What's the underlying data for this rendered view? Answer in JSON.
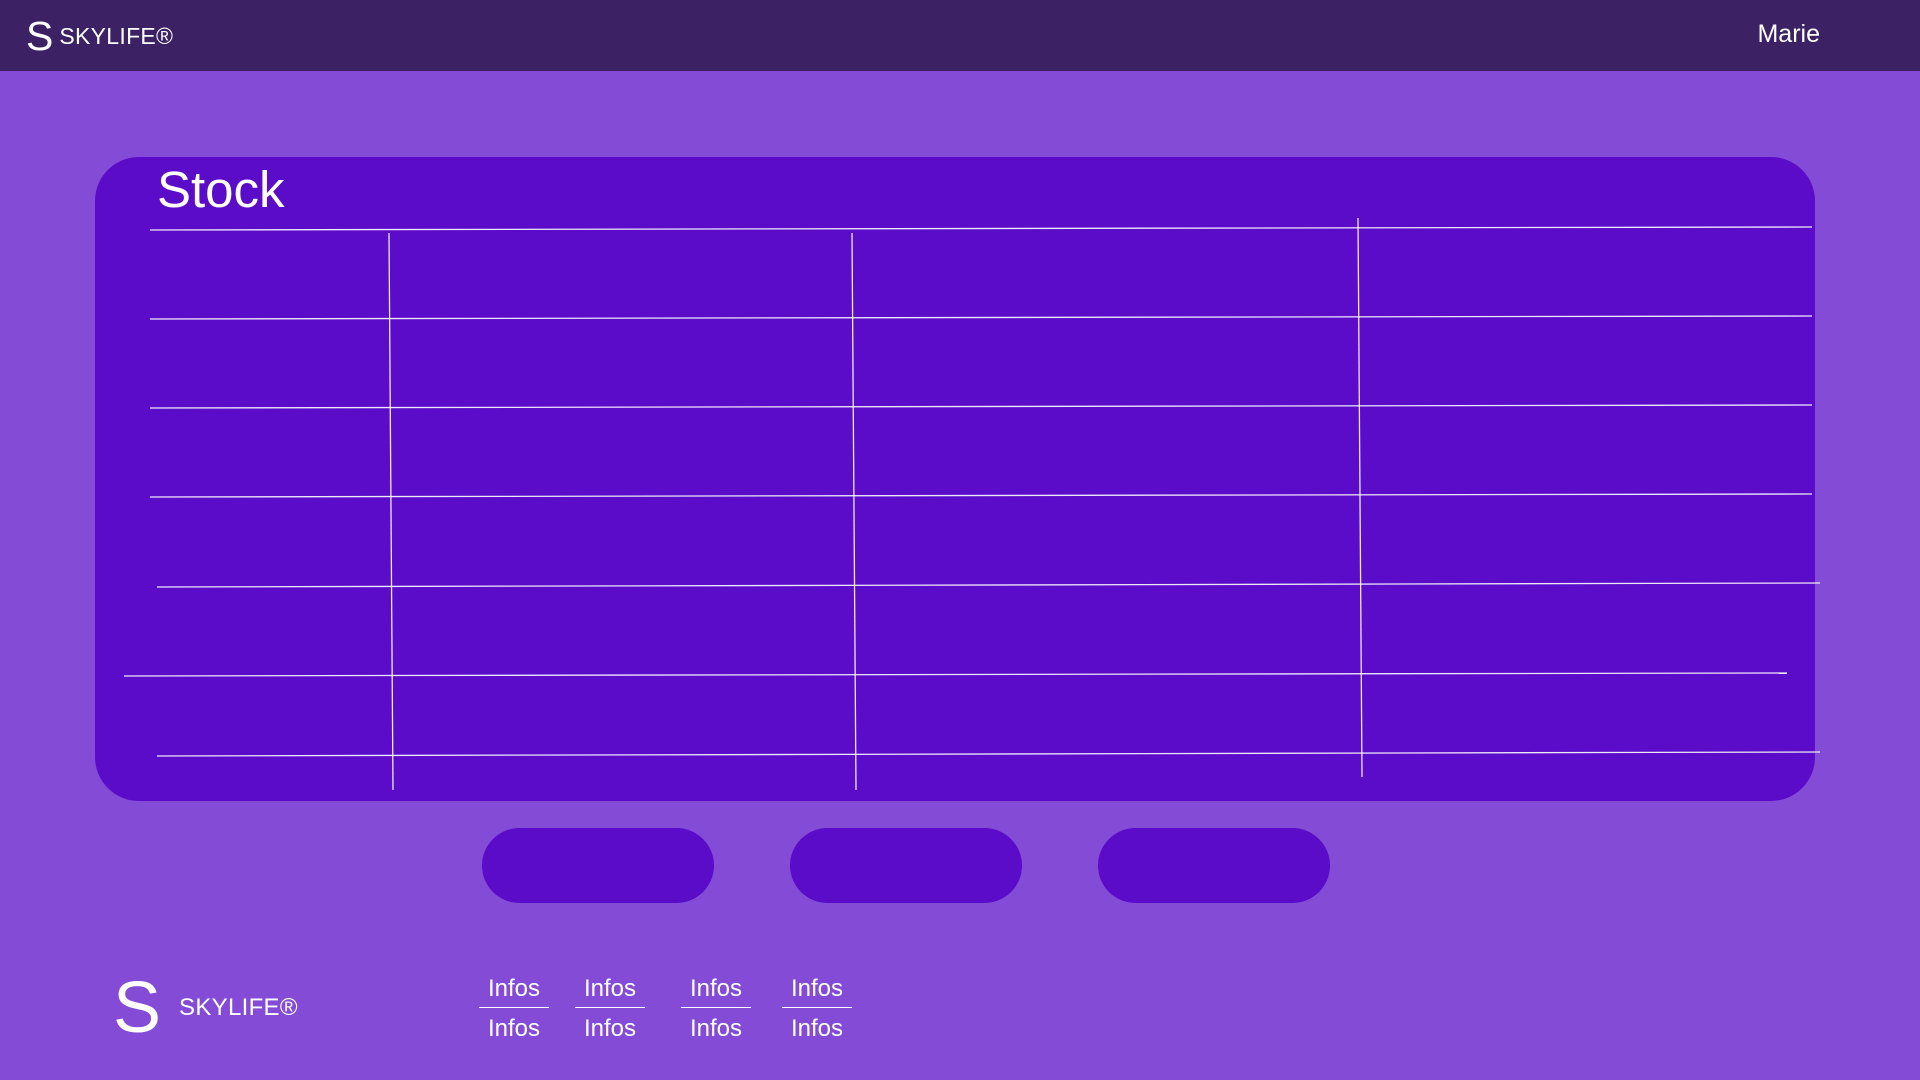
{
  "header": {
    "logo_letter": "S",
    "brand": "SKYLIFE®",
    "user": "Marie"
  },
  "main": {
    "title": "Stock",
    "table": {
      "rows": 6,
      "columns": 4
    },
    "buttons": [
      "",
      "",
      ""
    ]
  },
  "footer": {
    "logo_letter": "S",
    "brand": "SKYLIFE®",
    "links": [
      {
        "top": "Infos",
        "bottom": "Infos"
      },
      {
        "top": "Infos",
        "bottom": "Infos"
      },
      {
        "top": "Infos",
        "bottom": "Infos"
      },
      {
        "top": "Infos",
        "bottom": "Infos"
      }
    ]
  },
  "colors": {
    "page_background": "#834bd6",
    "header_background": "#3c2264",
    "card_background": "#5a0cc8",
    "text": "#ffffff"
  }
}
